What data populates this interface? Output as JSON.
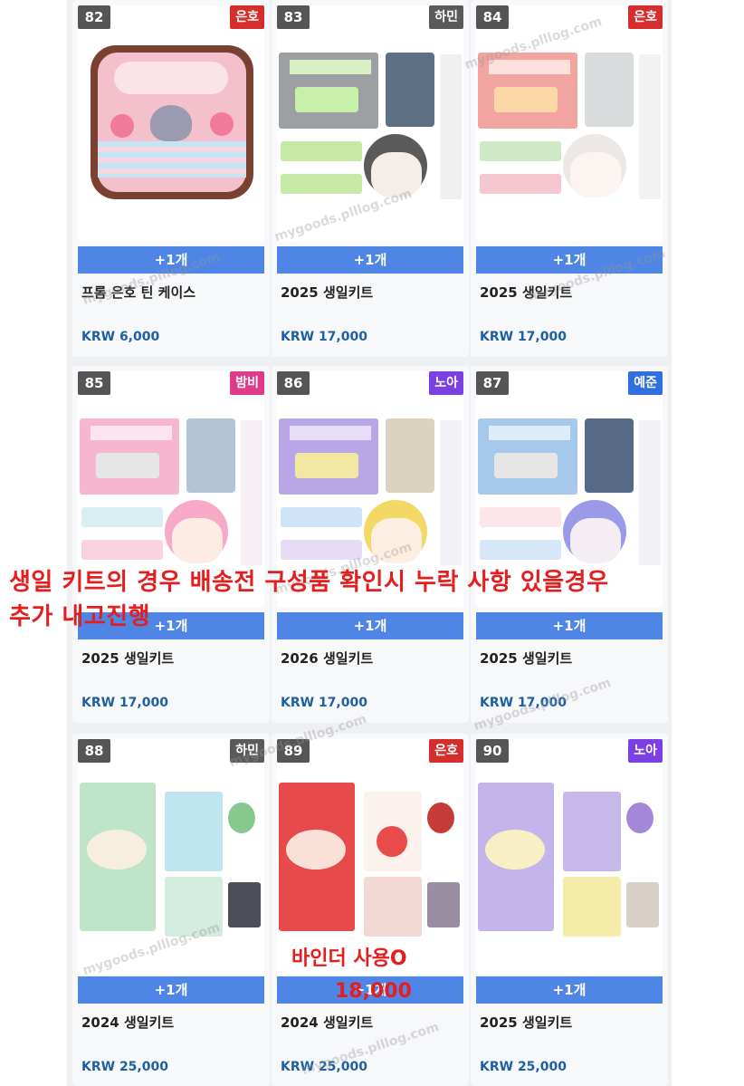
{
  "colors": {
    "eunho": "#d62d2d",
    "hamin": "#5a5a5a",
    "bambi": "#e03a8a",
    "noah": "#7b3fe4",
    "yejun": "#2f6fe0",
    "accent": "#4f86e6",
    "note": "#e41e1e"
  },
  "watermark": "mygoods.plllog.com",
  "add_label": "+1개",
  "products": [
    {
      "num": "82",
      "tag": "은호",
      "tag_color": "eunho",
      "name": "프롬 은호 틴 케이스",
      "price": "KRW 6,000"
    },
    {
      "num": "83",
      "tag": "하민",
      "tag_color": "hamin",
      "name": "2025 생일키트",
      "price": "KRW 17,000"
    },
    {
      "num": "84",
      "tag": "은호",
      "tag_color": "eunho",
      "name": "2025 생일키트",
      "price": "KRW 17,000"
    },
    {
      "num": "85",
      "tag": "밤비",
      "tag_color": "bambi",
      "name": "2025 생일키트",
      "price": "KRW 17,000"
    },
    {
      "num": "86",
      "tag": "노아",
      "tag_color": "noah",
      "name": "2026 생일키트",
      "price": "KRW 17,000"
    },
    {
      "num": "87",
      "tag": "예준",
      "tag_color": "yejun",
      "name": "2025 생일키트",
      "price": "KRW 17,000"
    },
    {
      "num": "88",
      "tag": "하민",
      "tag_color": "hamin",
      "name": "2024 생일키트",
      "price": "KRW 25,000"
    },
    {
      "num": "89",
      "tag": "은호",
      "tag_color": "eunho",
      "name": "2024 생일키트",
      "price": "KRW 25,000"
    },
    {
      "num": "90",
      "tag": "노아",
      "tag_color": "noah",
      "name": "2025 생일키트",
      "price": "KRW 25,000"
    }
  ],
  "notes": {
    "kit_line1": "생일 키트의 경우 배송전 구성품 확인시 누락 사항 있을경우",
    "kit_line2": "추가 내고진행",
    "binder_line1": "바인더 사용O",
    "binder_line2": "18,000"
  }
}
